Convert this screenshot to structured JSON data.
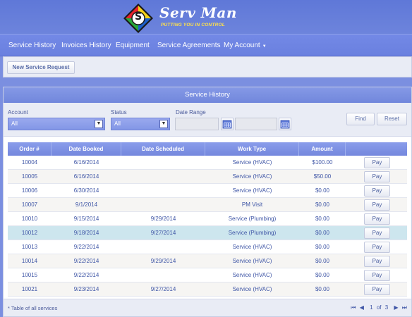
{
  "brand": {
    "name": "Serv Man",
    "tagline": "PUTTING YOU IN CONTROL",
    "logo_letter": "S"
  },
  "nav": {
    "items": [
      {
        "label": "Service History"
      },
      {
        "label": "Invoices History"
      },
      {
        "label": "Equipment"
      },
      {
        "label": "Service Agreements"
      },
      {
        "label": "My Account",
        "icon": "caret-down-icon"
      }
    ]
  },
  "toolbar": {
    "new_request_label": "New Service Request"
  },
  "panel": {
    "title": "Service History",
    "filters": {
      "account_label": "Account",
      "account_value": "All",
      "status_label": "Status",
      "status_value": "All",
      "date_range_label": "Date Range",
      "date_from": "",
      "date_to": "",
      "find_label": "Find",
      "reset_label": "Reset"
    },
    "table": {
      "columns": [
        "Order #",
        "Date Booked",
        "Date Scheduled",
        "Work Type",
        "Amount",
        ""
      ],
      "pay_label": "Pay",
      "rows": [
        {
          "order": "10004",
          "booked": "6/16/2014",
          "scheduled": "",
          "work_type": "Service (HVAC)",
          "amount": "$100.00"
        },
        {
          "order": "10005",
          "booked": "6/16/2014",
          "scheduled": "",
          "work_type": "Service (HVAC)",
          "amount": "$50.00"
        },
        {
          "order": "10006",
          "booked": "6/30/2014",
          "scheduled": "",
          "work_type": "Service (HVAC)",
          "amount": "$0.00"
        },
        {
          "order": "10007",
          "booked": "9/1/2014",
          "scheduled": "",
          "work_type": "PM Visit",
          "amount": "$0.00"
        },
        {
          "order": "10010",
          "booked": "9/15/2014",
          "scheduled": "9/29/2014",
          "work_type": "Service (Plumbing)",
          "amount": "$0.00"
        },
        {
          "order": "10012",
          "booked": "9/18/2014",
          "scheduled": "9/27/2014",
          "work_type": "Service (Plumbing)",
          "amount": "$0.00",
          "selected": true
        },
        {
          "order": "10013",
          "booked": "9/22/2014",
          "scheduled": "",
          "work_type": "Service (HVAC)",
          "amount": "$0.00"
        },
        {
          "order": "10014",
          "booked": "9/22/2014",
          "scheduled": "9/29/2014",
          "work_type": "Service (HVAC)",
          "amount": "$0.00"
        },
        {
          "order": "10015",
          "booked": "9/22/2014",
          "scheduled": "",
          "work_type": "Service (HVAC)",
          "amount": "$0.00"
        },
        {
          "order": "10021",
          "booked": "9/23/2014",
          "scheduled": "9/27/2014",
          "work_type": "Service (HVAC)",
          "amount": "$0.00"
        }
      ]
    },
    "footer": {
      "note": "* Table of all services",
      "page_current": "1",
      "page_of": "of",
      "page_total": "3"
    }
  },
  "colors": {
    "accent": "#6a80df",
    "header": "#7a8de3",
    "selected_row": "#cde6ee",
    "text": "#3f56a6"
  }
}
